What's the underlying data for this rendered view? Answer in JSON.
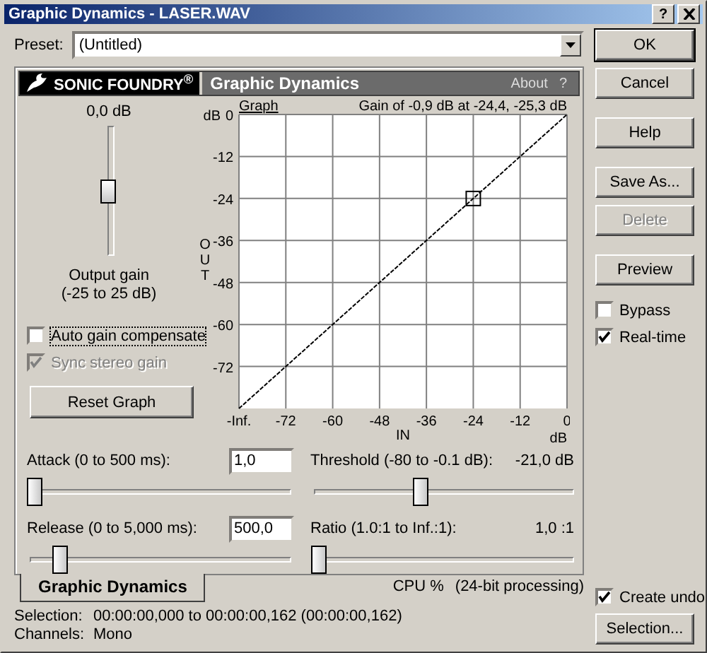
{
  "window": {
    "title": "Graphic Dynamics - LASER.WAV",
    "help_button": "?"
  },
  "preset": {
    "label": "Preset:",
    "value": "(Untitled)"
  },
  "header": {
    "logo": "SONIC FOUNDRY$^{®}$",
    "title": "Graphic Dynamics",
    "about": "About",
    "help": "?"
  },
  "output": {
    "reading": "0,0 dB",
    "level": 0.5,
    "label": "Output gain",
    "range": "(-25 to 25 dB)"
  },
  "options": [
    {
      "label": "Auto gain compensate",
      "checked": false,
      "disabled": false
    },
    {
      "label": "Sync stereo gain",
      "checked": true,
      "disabled": true
    }
  ],
  "reset_button": "Reset Graph",
  "graph": {
    "label": "Graph",
    "readout": "Gain of -0,9 dB at -24,4, -25,3 dB",
    "y_unit": "dB",
    "x_unit": "dB",
    "chart_data": {
      "type": "line",
      "grid": true,
      "line_style": "dashed",
      "xlabel": "IN",
      "ylabel": "OUT",
      "x": [
        -84,
        -24,
        0
      ],
      "values": [
        -84,
        -24,
        0
      ],
      "xlim": [
        -84,
        0
      ],
      "ylim": [
        -84,
        0
      ],
      "xticks": [
        {
          "value": -84,
          "label": "-Inf."
        },
        -72,
        -60,
        -48,
        -36,
        -24,
        -12,
        0
      ],
      "yticks": [
        0,
        -12,
        -24,
        -36,
        -48,
        -60,
        -72
      ]
    }
  },
  "params": [
    {
      "label": "Attack (0 to 500 ms):",
      "kind": "field",
      "value": "1,0",
      "level": 0.0
    },
    {
      "label": "Threshold (-80 to -0.1 dB):",
      "kind": "reading",
      "value": "-21,0 dB",
      "level": 0.41
    },
    {
      "label": "Release (0 to 5,000 ms):",
      "kind": "field",
      "value": "500,0",
      "level": 0.1
    },
    {
      "label": "Ratio (1.0:1 to Inf.:1):",
      "kind": "reading",
      "value": "1,0 :1",
      "level": 0.0
    }
  ],
  "panel_tab": {
    "label": "Graphic Dynamics",
    "selected": true
  },
  "cpu": {
    "label": "CPU %",
    "note": "(24-bit processing)"
  },
  "status": [
    {
      "label": "Selection:",
      "value": "00:00:00,000 to 00:00:00,162 (00:00:00,162)"
    },
    {
      "label": "Channels:",
      "value": "Mono"
    }
  ],
  "buttons": [
    {
      "label": "OK",
      "disabled": false,
      "default": true
    },
    {
      "label": "Cancel",
      "disabled": false,
      "default": false
    },
    {
      "label": "Help",
      "disabled": false,
      "default": false
    },
    {
      "label": "Save As...",
      "disabled": false,
      "default": false
    },
    {
      "label": "Delete",
      "disabled": true,
      "default": false
    },
    {
      "label": "Preview",
      "disabled": false,
      "default": false
    }
  ],
  "toggles": [
    {
      "label": "Bypass",
      "checked": false
    },
    {
      "label": "Real-time",
      "checked": true
    }
  ],
  "create_undo": {
    "label": "Create undo",
    "checked": true
  },
  "selection_button": "Selection..."
}
